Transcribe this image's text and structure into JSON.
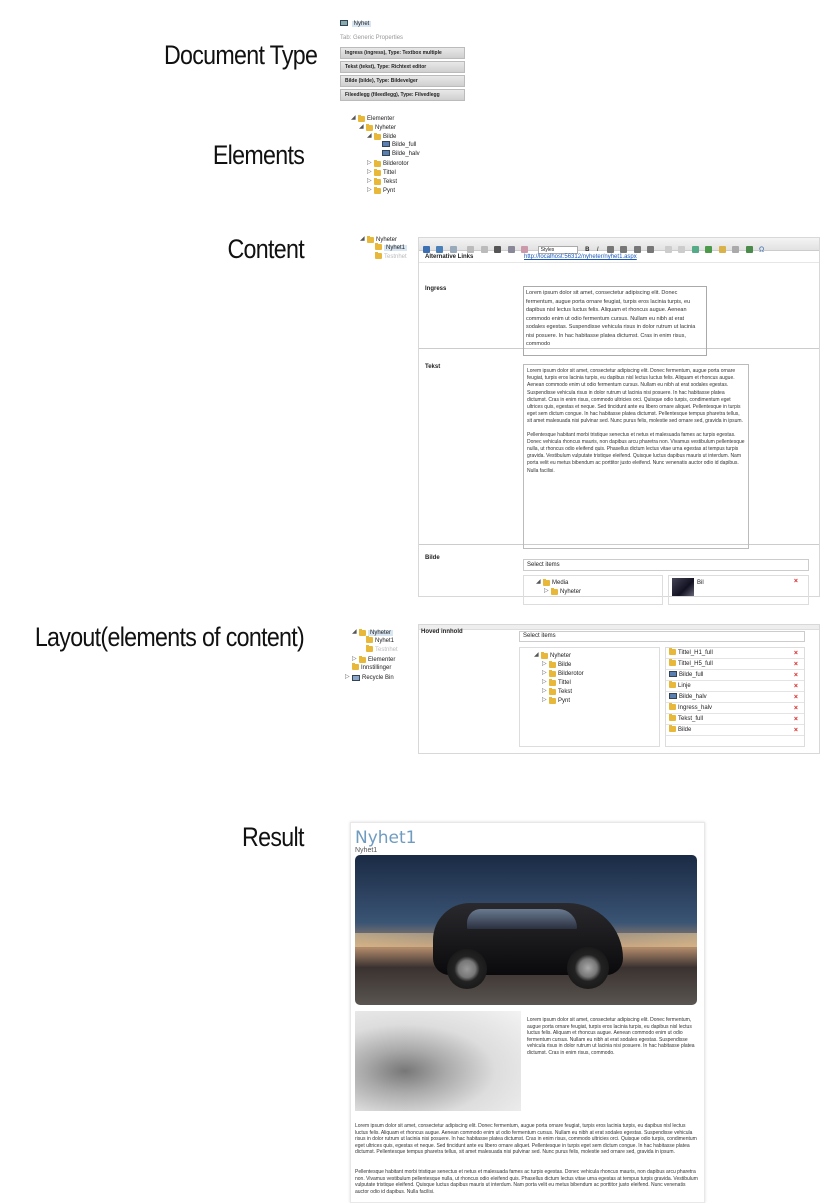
{
  "labels": {
    "document_type": "Document Type",
    "elements": "Elements",
    "content": "Content",
    "layout": "Layout(elements of content)",
    "result": "Result"
  },
  "doctype": {
    "node": "Nyhet",
    "tab": "Tab: Generic Properties",
    "properties": [
      "Ingress (ingress), Type: Textbox multiple",
      "Tekst (tekst), Type: Richtext editor",
      "Bilde (bilde), Type: Bildevelger",
      "Fileedlegg (fileedlegg), Type: Filvedlegg"
    ]
  },
  "elements_tree": [
    {
      "label": "Elementer",
      "level": 0,
      "arrow": "◢",
      "icon": "folder"
    },
    {
      "label": "Nyheter",
      "level": 1,
      "arrow": "◢",
      "icon": "folder"
    },
    {
      "label": "Bilde",
      "level": 2,
      "arrow": "◢",
      "icon": "folder"
    },
    {
      "label": "Bilde_full",
      "level": 3,
      "arrow": "",
      "icon": "image"
    },
    {
      "label": "Bilde_halv",
      "level": 3,
      "arrow": "",
      "icon": "image"
    },
    {
      "label": "Bilderotor",
      "level": 2,
      "arrow": "▷",
      "icon": "folder"
    },
    {
      "label": "Tittel",
      "level": 2,
      "arrow": "▷",
      "icon": "folder"
    },
    {
      "label": "Tekst",
      "level": 2,
      "arrow": "▷",
      "icon": "folder"
    },
    {
      "label": "Pynt",
      "level": 2,
      "arrow": "▷",
      "icon": "folder"
    }
  ],
  "content": {
    "tree": [
      {
        "label": "Nyheter",
        "level": 0,
        "arrow": "◢",
        "icon": "folder"
      },
      {
        "label": "Nyhet1",
        "level": 1,
        "arrow": "",
        "icon": "folder",
        "selected": true
      },
      {
        "label": "Testnhet",
        "level": 1,
        "arrow": "",
        "icon": "folder",
        "faded": true
      }
    ],
    "toolbar_styles": "Styles",
    "alt_links_label": "Alternative Links",
    "alt_links_url": "http://localhost:56312/nyheter/nyhet1.aspx",
    "ingress_label": "Ingress",
    "ingress_text": "Lorem ipsum dolor sit amet, consectetur adipiscing elit. Donec fermentum, augue porta ornare feugiat, turpis eros lacinia turpis, eu dapibus nisl lectus luctus felis. Aliquam et rhoncus augue. Aenean commodo enim ut odio fermentum cursus. Nullam eu nibh at erat sodales egestas. Suspendisse vehicula risus in dolor rutrum ut lacinia nisi posuere. In hac habitasse platea dictumst. Cras in enim risus, commodo",
    "tekst_label": "Tekst",
    "tekst_p1": "Lorem ipsum dolor sit amet, consectetur adipiscing elit. Donec fermentum, augue porta ornare feugiat, turpis eros lacinia turpis, eu dapibus nisl lectus luctus felis. Aliquam et rhoncus augue. Aenean commodo enim ut odio fermentum cursus. Nullam eu nibh at erat sodales egestas. Suspendisse vehicula risus in dolor rutrum ut lacinia nisi posuere. In hac habitasse platea dictumst. Cras in enim risus, commodo ultricies orci. Quisque odio turpis, condimentum eget ultrices quis, egestas et neque. Sed tincidunt ante eu libero ornare aliquet. Pellentesque in turpis eget sem dictum congue. In hac habitasse platea dictumst. Pellentesque tempus pharetra tellus, sit amet malesuada nisi pulvinar sed. Nunc purus felis, molestie sed ornare sed, gravida in ipsum.",
    "tekst_p2": "Pellentesque habitant morbi tristique senectus et netus et malesuada fames ac turpis egestas. Donec vehicula rhoncus mauris, non dapibus arcu pharetra non. Vivamus vestibulum pellentesque nulla, ut rhoncus odio eleifend quis. Phasellus dictum lectus vitae urna egestas at tempus turpis gravida. Vestibulum vulputate tristique eleifend. Quisque luctus dapibus mauris ut interdum. Nam porta velit eu metus bibendum ac porttitor justo eleifend. Nunc venenatis auctor odio id dapibus. Nulla facilisi.",
    "bilde_label": "Bilde",
    "select_items": "Select items",
    "media_tree": [
      {
        "label": "Media",
        "level": 0,
        "arrow": "◢"
      },
      {
        "label": "Nyheter",
        "level": 1,
        "arrow": "▷"
      }
    ],
    "selected_image_label": "Bil"
  },
  "layout": {
    "tree": [
      {
        "label": "Nyheter",
        "level": 0,
        "arrow": "◢",
        "icon": "folder",
        "selected": true
      },
      {
        "label": "Nyhet1",
        "level": 1,
        "arrow": "",
        "icon": "folder"
      },
      {
        "label": "Testnhet",
        "level": 1,
        "arrow": "",
        "icon": "folder",
        "faded": true
      },
      {
        "label": "Elementer",
        "level": 0,
        "arrow": "▷",
        "icon": "folder"
      },
      {
        "label": "Innstillinger",
        "level": -1,
        "arrow": "",
        "icon": "folder"
      },
      {
        "label": "Recycle Bin",
        "level": -1,
        "arrow": "▷",
        "icon": "bin"
      }
    ],
    "field_label": "Hoved innhold",
    "select_items": "Select items",
    "picker_tree": [
      {
        "label": "Nyheter",
        "level": 0,
        "arrow": "◢"
      },
      {
        "label": "Bilde",
        "level": 1,
        "arrow": "▷"
      },
      {
        "label": "Bilderotor",
        "level": 1,
        "arrow": "▷"
      },
      {
        "label": "Tittel",
        "level": 1,
        "arrow": "▷"
      },
      {
        "label": "Tekst",
        "level": 1,
        "arrow": "▷"
      },
      {
        "label": "Pynt",
        "level": 1,
        "arrow": "▷"
      }
    ],
    "selected": [
      {
        "label": "Tittel_H1_full",
        "icon": "folder"
      },
      {
        "label": "Tittel_H5_full",
        "icon": "folder"
      },
      {
        "label": "Bilde_full",
        "icon": "image"
      },
      {
        "label": "Linje",
        "icon": "folder"
      },
      {
        "label": "Bilde_halv",
        "icon": "image"
      },
      {
        "label": "Ingress_halv",
        "icon": "folder"
      },
      {
        "label": "Tekst_full",
        "icon": "folder"
      },
      {
        "label": "Bilde",
        "icon": "folder"
      }
    ]
  },
  "result": {
    "title": "Nyhet1",
    "subtitle": "Nyhet1",
    "ingress": "Lorem ipsum dolor sit amet, consectetur adipiscing elit. Donec fermentum, augue porta ornare feugiat, turpis eros lacinia turpis, eu dapibus nisl lectus luctus felis. Aliquam et rhoncus augue. Aenean commodo enim ut odio fermentum cursus. Nullam eu nibh at erat sodales egestas. Suspendisse vehicula risus in dolor rutrum ut lacinia nisi posuere. In hac habitasse platea dictumst. Cras in enim risus, commodo.",
    "p1": "Lorem ipsum dolor sit amet, consectetur adipiscing elit. Donec fermentum, augue porta ornare feugiat, turpis eros lacinia turpis, eu dapibus nisl lectus luctus felis. Aliquam et rhoncus augue. Aenean commodo enim ut odio fermentum cursus. Nullam eu nibh at erat sodales egestas. Suspendisse vehicula risus in dolor rutrum ut lacinia nisi posuere. In hac habitasse platea dictumst. Cras in enim risus, commodo ultricies orci. Quisque odio turpis, condimentum eget ultrices quis, egestas et neque. Sed tincidunt ante eu libero ornare aliquet. Pellentesque in turpis eget sem dictum congue. In hac habitasse platea dictumst. Pellentesque tempus pharetra tellus, sit amet malesuada nisi pulvinar sed. Nunc purus felis, molestie sed ornare sed, gravida in ipsum.",
    "p2": "Pellentesque habitant morbi tristique senectus et netus et malesuada fames ac turpis egestas. Donec vehicula rhoncus mauris, non dapibus arcu pharetra non. Vivamus vestibulum pellentesque nulla, ut rhoncus odio eleifend quis. Phasellus dictum lectus vitae urna egestas at tempus turpis gravida. Vestibulum vulputate tristique eleifend. Quisque luctus dapibus mauris ut interdum. Nam porta velit eu metus bibendum ac porttitor justo eleifend. Nunc venenatis auctor odio id dapibus. Nulla facilisi."
  }
}
